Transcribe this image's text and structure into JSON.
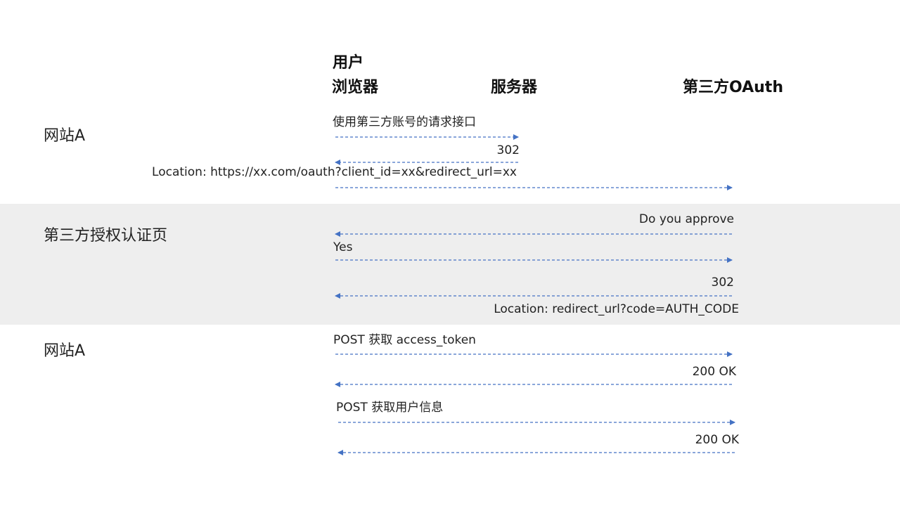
{
  "headers": {
    "user_line1": "用户",
    "user_line2": "浏览器",
    "server": "服务器",
    "oauth": "第三方OAuth"
  },
  "sections": [
    {
      "label": "网站A"
    },
    {
      "label": "第三方授权认证页"
    },
    {
      "label": "网站A"
    }
  ],
  "messages": [
    {
      "text": "使用第三方账号的请求接口"
    },
    {
      "text": "302"
    },
    {
      "text": "Location: https://xx.com/oauth?client_id=xx&redirect_url=xx"
    },
    {
      "text": "Do you approve"
    },
    {
      "text": "Yes"
    },
    {
      "text": "302"
    },
    {
      "text": "Location: redirect_url?code=AUTH_CODE"
    },
    {
      "text": "POST 获取 access_token"
    },
    {
      "text": "200 OK"
    },
    {
      "text": "POST 获取用户信息"
    },
    {
      "text": "200 OK"
    }
  ],
  "colors": {
    "arrow": "#4472c4",
    "band": "#eeeeee"
  }
}
